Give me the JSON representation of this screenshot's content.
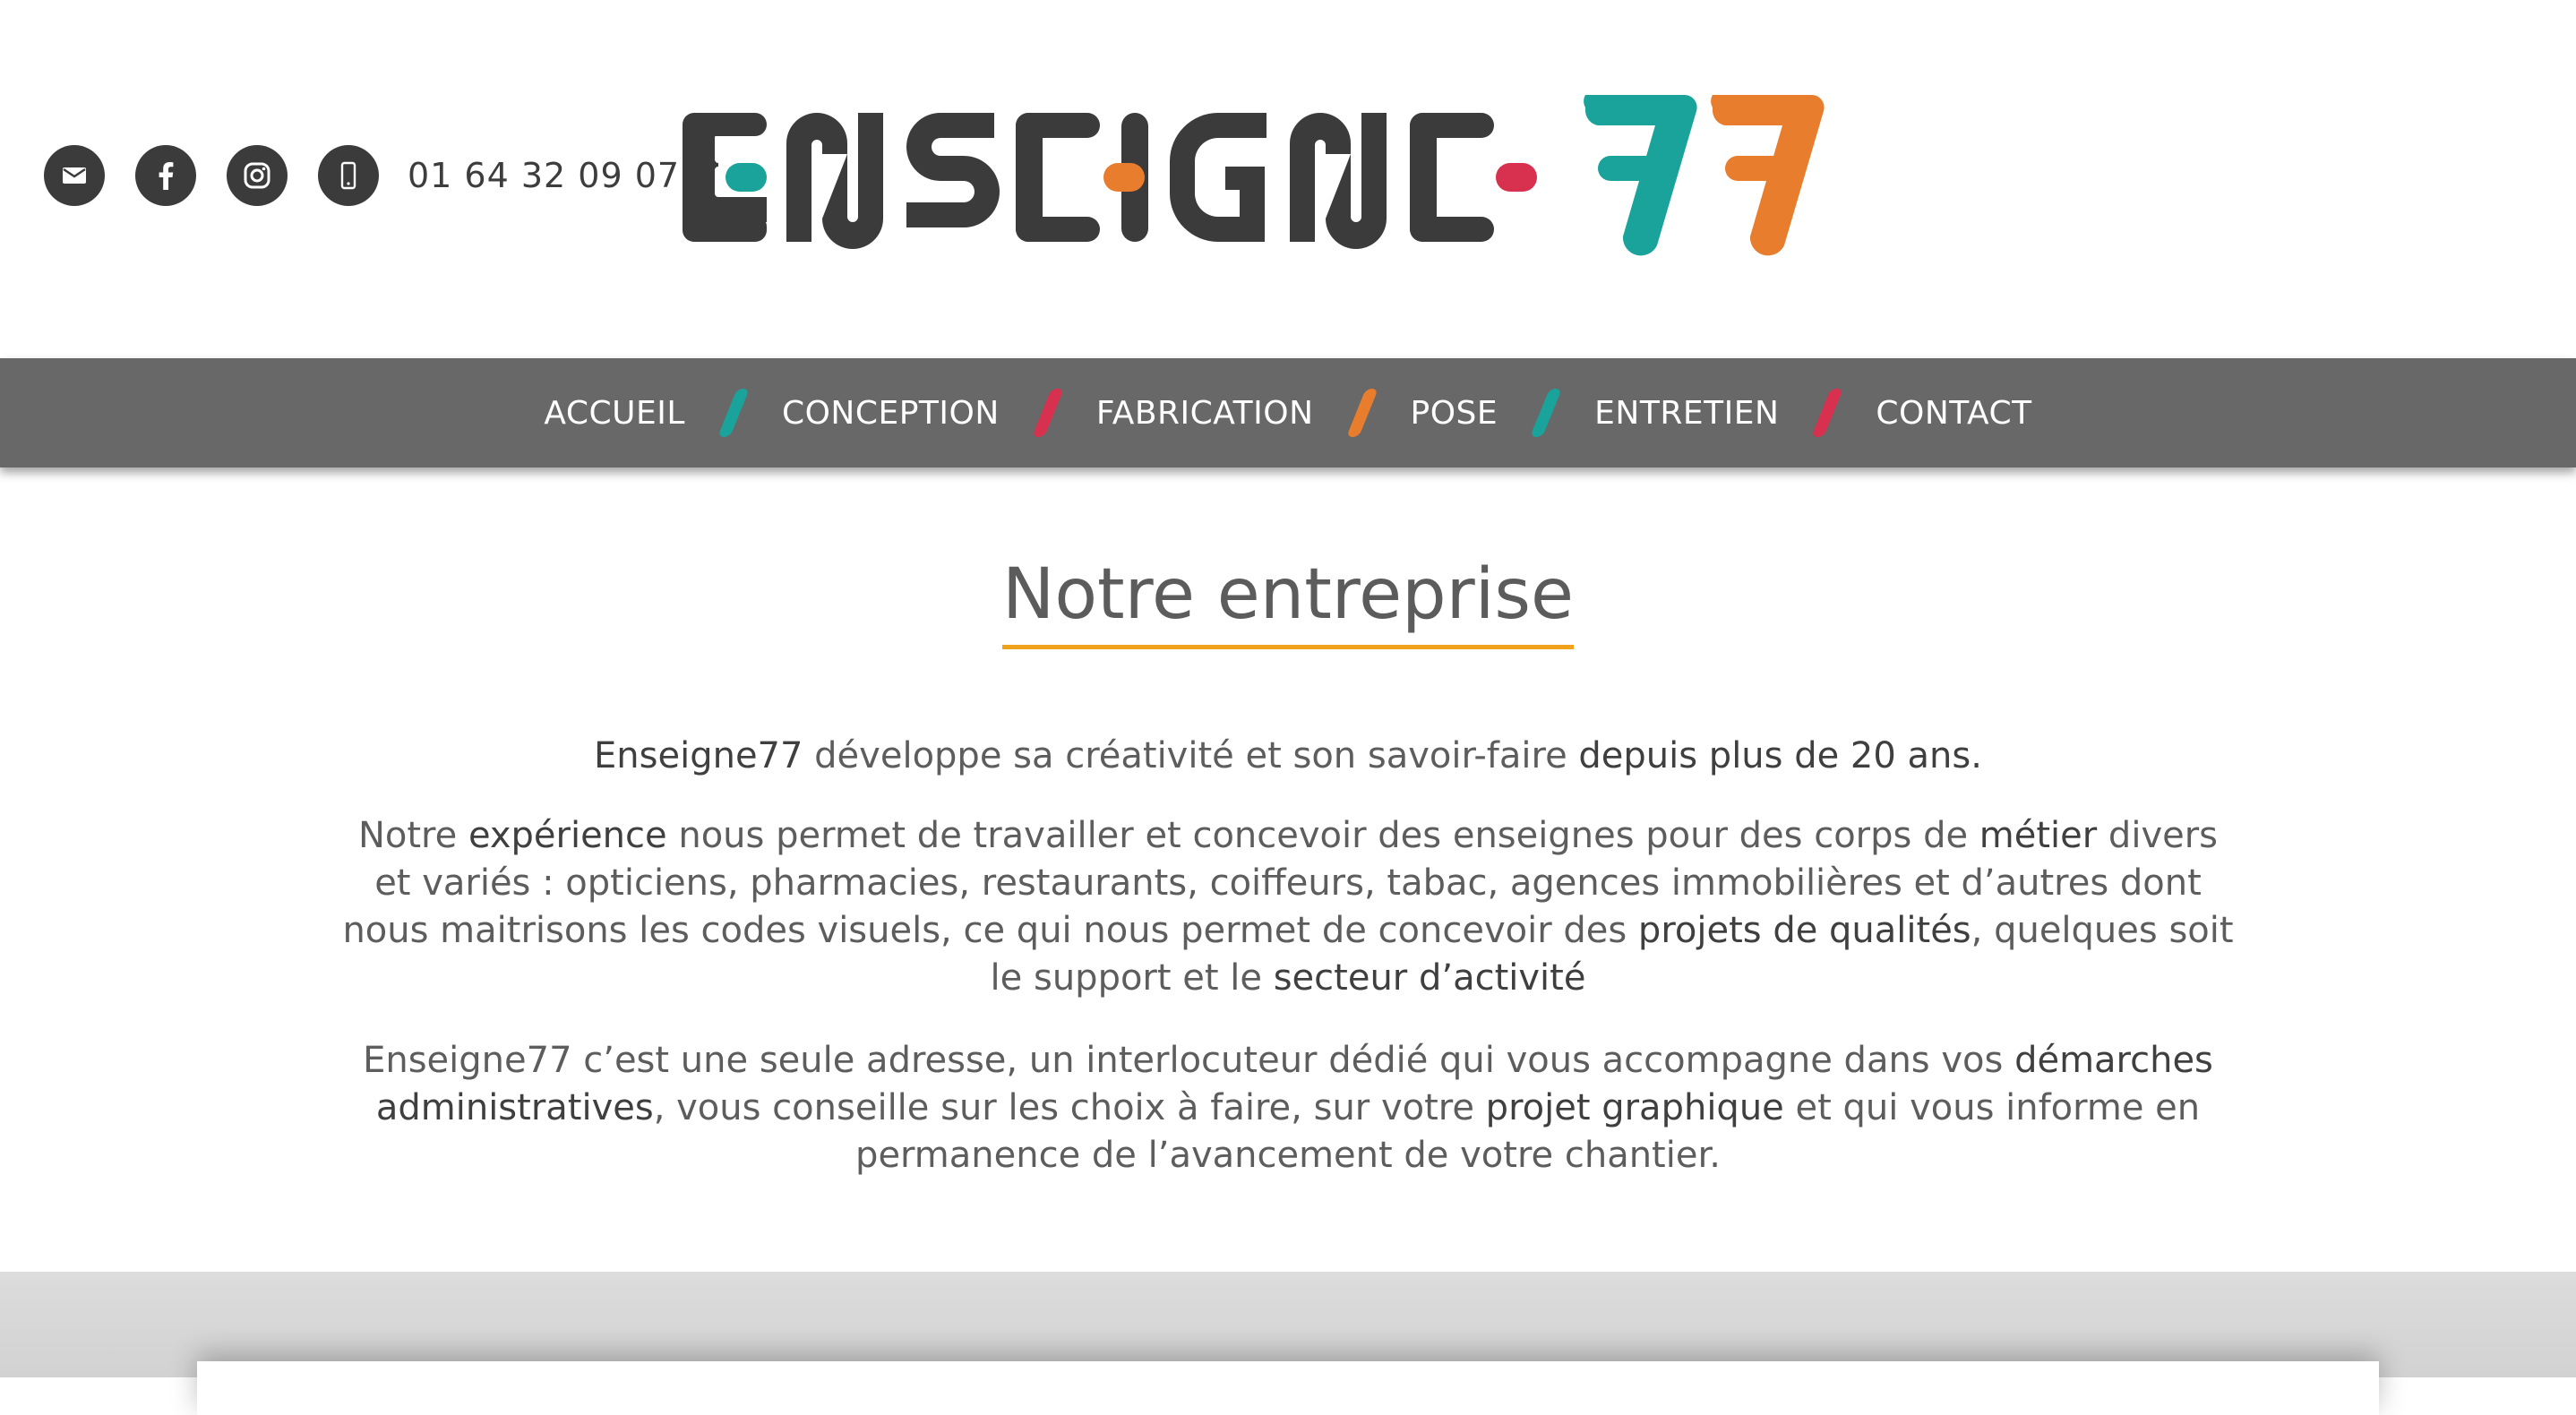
{
  "header": {
    "social": [
      {
        "name": "email",
        "icon": "envelope-icon"
      },
      {
        "name": "facebook",
        "icon": "facebook-icon"
      },
      {
        "name": "instagram",
        "icon": "instagram-icon"
      },
      {
        "name": "mobile",
        "icon": "phone-icon"
      }
    ],
    "phone": "01 64 32 09 07",
    "logo": {
      "text": "ENSEIGNE",
      "number": "77",
      "colors": {
        "dark": "#3b3b3b",
        "teal": "#1aa39a",
        "orange": "#e87d2e",
        "pink": "#d8304f"
      }
    }
  },
  "nav": {
    "items": [
      "ACCUEIL",
      "CONCEPTION",
      "FABRICATION",
      "POSE",
      "ENTRETIEN",
      "CONTACT"
    ],
    "separator_colors": [
      "#1aa39a",
      "#d8304f",
      "#e87d2e",
      "#1aa39a",
      "#d8304f"
    ],
    "background": "#686868"
  },
  "main": {
    "title": "Notre entreprise",
    "title_underline_color": "#f0a21c",
    "p1": {
      "a": "Enseigne77",
      "b": " développe sa créativité et son savoir-faire ",
      "c": "depuis plus de 20 ans."
    },
    "p2": {
      "a": "Notre ",
      "b": "expérience",
      "c": " nous permet de travailler et concevoir des enseignes pour des corps de ",
      "d": "métier",
      "e": " divers et variés : opticiens, pharmacies, restaurants, coiffeurs, tabac, agences immobilières et d’autres dont nous maitrisons les codes visuels, ce qui nous permet de concevoir des ",
      "f": "projets de qualités",
      "g": ", quelques soit le support et le ",
      "h": "secteur d’activité"
    },
    "p3": {
      "a": "Enseigne77 c’est une seule adresse, un interlocuteur dédié qui vous accompagne dans vos ",
      "b": "démarches administratives",
      "c": ", vous conseille sur les choix à faire, sur votre ",
      "d": "projet graphique",
      "e": " et qui vous informe en permanence de l’avancement de votre chantier."
    }
  }
}
